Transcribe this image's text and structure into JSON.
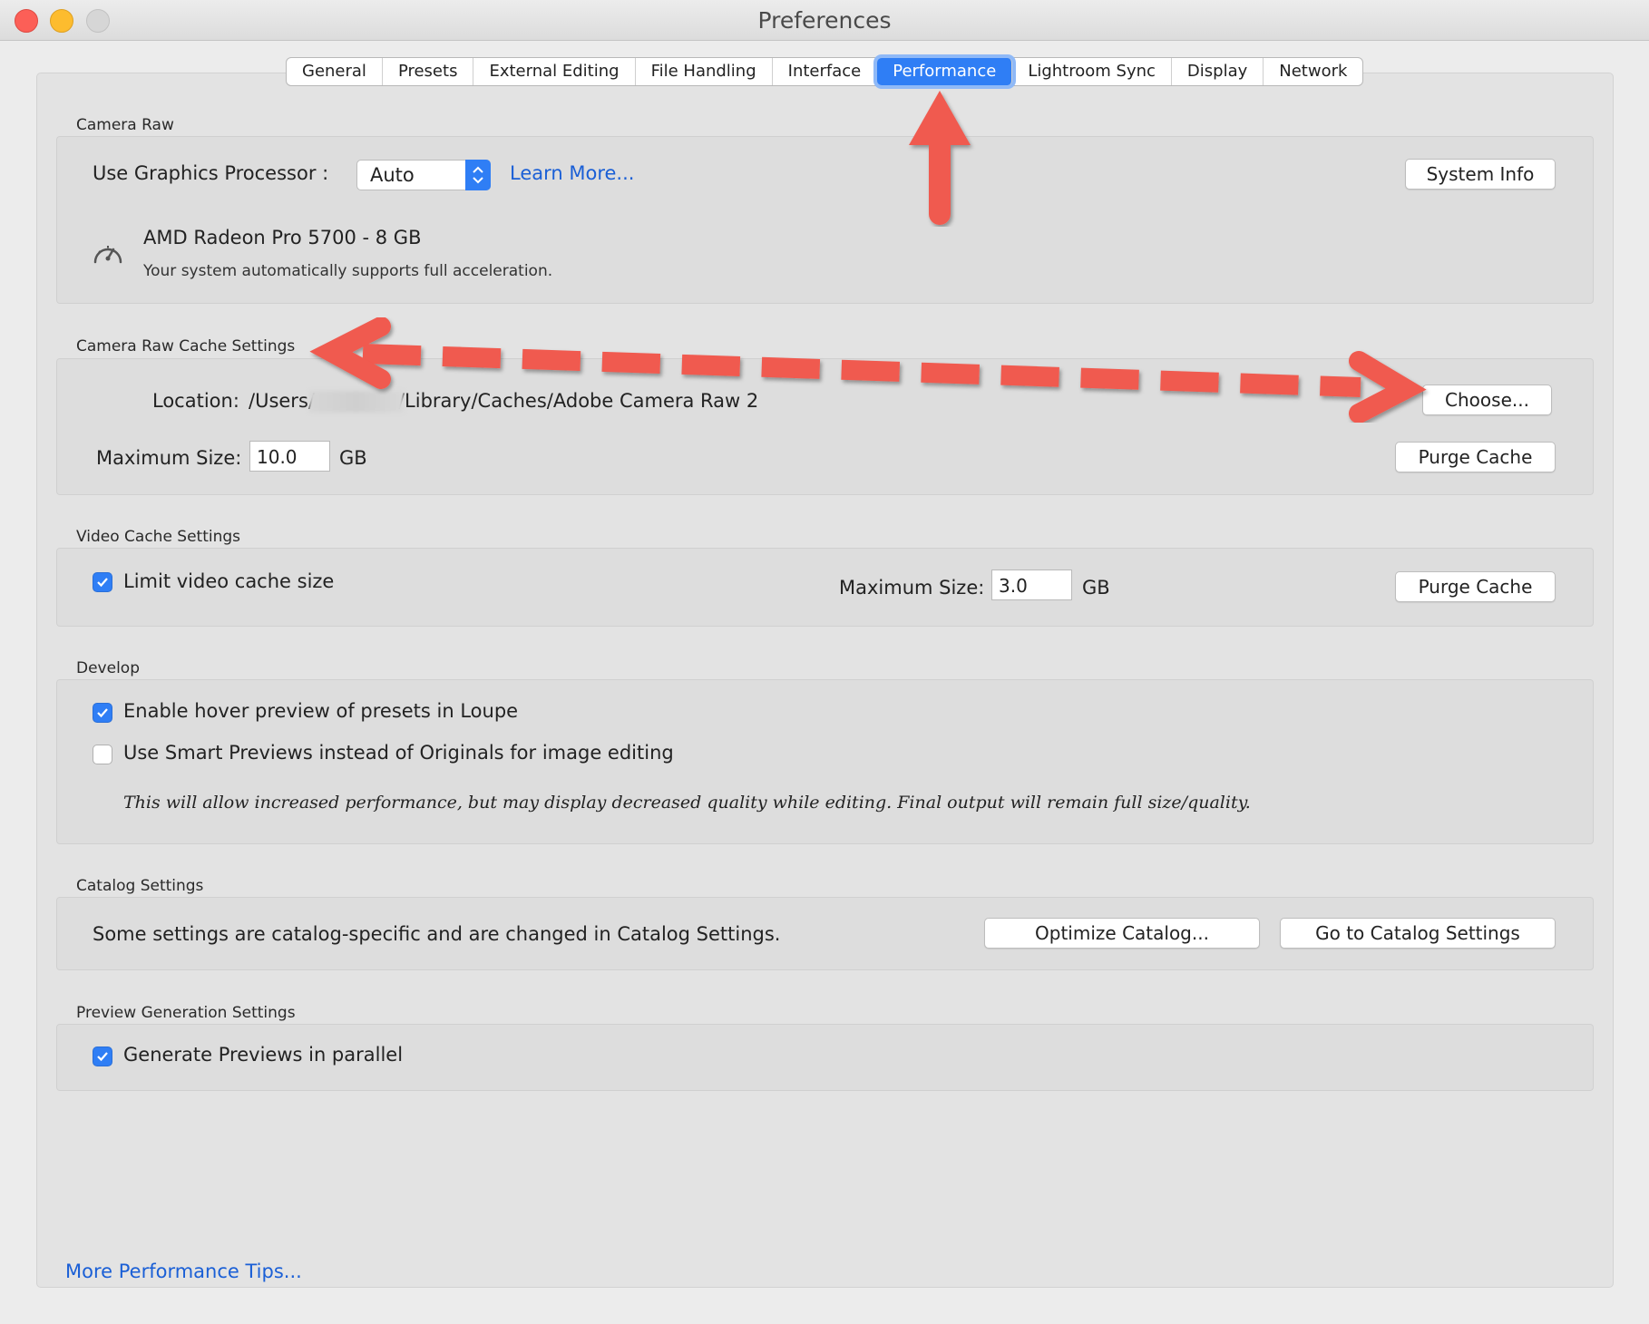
{
  "window": {
    "title": "Preferences"
  },
  "tabs": [
    {
      "label": "General"
    },
    {
      "label": "Presets"
    },
    {
      "label": "External Editing"
    },
    {
      "label": "File Handling"
    },
    {
      "label": "Interface"
    },
    {
      "label": "Performance",
      "active": true
    },
    {
      "label": "Lightroom Sync"
    },
    {
      "label": "Display"
    },
    {
      "label": "Network"
    }
  ],
  "camera_raw": {
    "title": "Camera Raw",
    "gpu_label": "Use Graphics Processor :",
    "gpu_value": "Auto",
    "learn_more": "Learn More...",
    "system_info": "System Info",
    "gpu_name": "AMD Radeon Pro 5700 - 8 GB",
    "gpu_status": "Your system automatically supports full acceleration."
  },
  "cache": {
    "title": "Camera Raw Cache Settings",
    "location_label": "Location:",
    "location_prefix": "/Users/",
    "location_suffix": "/Library/Caches/Adobe Camera Raw 2",
    "choose": "Choose...",
    "max_label": "Maximum Size:",
    "max_value": "10.0",
    "unit": "GB",
    "purge": "Purge Cache"
  },
  "video": {
    "title": "Video Cache Settings",
    "limit_label": "Limit video cache size",
    "limit_checked": true,
    "max_label": "Maximum Size:",
    "max_value": "3.0",
    "unit": "GB",
    "purge": "Purge Cache"
  },
  "develop": {
    "title": "Develop",
    "hover_label": "Enable hover preview of presets in Loupe",
    "hover_checked": true,
    "smart_label": "Use Smart Previews instead of Originals for image editing",
    "smart_checked": false,
    "note": "This will allow increased performance, but may display decreased quality while editing. Final output will remain full size/quality."
  },
  "catalog": {
    "title": "Catalog Settings",
    "text": "Some settings are catalog-specific and are changed in Catalog Settings.",
    "optimize": "Optimize Catalog...",
    "goto": "Go to Catalog Settings"
  },
  "preview": {
    "title": "Preview Generation Settings",
    "parallel_label": "Generate Previews in parallel",
    "parallel_checked": true
  },
  "footer": {
    "tips": "More Performance Tips..."
  },
  "colors": {
    "accent": "#2f7ef5",
    "annotation": "#f05a4f",
    "link": "#1a5fd6"
  }
}
